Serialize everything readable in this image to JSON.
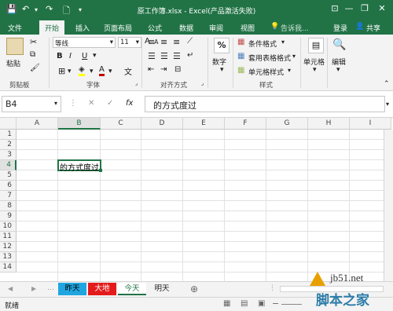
{
  "window": {
    "title": "原工作簿.xlsx - Excel(产品激活失败)",
    "minimize": "—",
    "restore": "❐",
    "close": "✕",
    "ribbon_options": "⊡"
  },
  "quick_access": {
    "save": "💾",
    "undo": "↶",
    "redo": "↷",
    "new": "🗋",
    "customize": "▾"
  },
  "tabs": [
    {
      "label": "文件"
    },
    {
      "label": "开始"
    },
    {
      "label": "插入"
    },
    {
      "label": "页面布局"
    },
    {
      "label": "公式"
    },
    {
      "label": "数据"
    },
    {
      "label": "审阅"
    },
    {
      "label": "视图"
    }
  ],
  "tell_me": "告诉我...",
  "login": "登录",
  "share": "共享",
  "ribbon": {
    "clipboard": {
      "paste": "粘贴",
      "label": "剪贴板"
    },
    "font": {
      "name": "等线",
      "size": "11",
      "bold": "B",
      "italic": "I",
      "underline": "U",
      "grow": "A",
      "shrink": "A",
      "label": "字体",
      "font_color_letter": "A",
      "font_color": "#c00000",
      "fill_color": "#ffff00"
    },
    "alignment": {
      "label": "对齐方式"
    },
    "number": {
      "pct": "%",
      "label": "数字"
    },
    "styles": {
      "conditional": "条件格式",
      "table": "套用表格格式",
      "cell_styles": "单元格样式",
      "label": "样式"
    },
    "cells": {
      "label": "单元格"
    },
    "editing": {
      "label": "编辑"
    }
  },
  "formula_bar": {
    "name_box": "B4",
    "cancel": "✕",
    "enter": "✓",
    "fx": "fx",
    "content": "的方式度过"
  },
  "grid": {
    "columns": [
      "A",
      "B",
      "C",
      "D",
      "E",
      "F",
      "G",
      "H",
      "I"
    ],
    "rows": [
      "1",
      "2",
      "3",
      "4",
      "5",
      "6",
      "7",
      "8",
      "9",
      "10",
      "11",
      "12",
      "13",
      "14"
    ],
    "active_cell": "B4",
    "cell_B4": "的方式度过",
    "accent": "#217346"
  },
  "sheets": [
    {
      "label": "昨天",
      "color": "#1fa6e0"
    },
    {
      "label": "大地",
      "color": "#e41b1b"
    },
    {
      "label": "今天",
      "color": "#ffffff"
    },
    {
      "label": "明天",
      "color": "#f3f3f3"
    }
  ],
  "sheet_nav": {
    "prev": "◀",
    "next": "▶",
    "add": "⊕"
  },
  "status": {
    "mode": "就绪"
  },
  "watermark": {
    "site": "jb51.net",
    "name": "脚本之家"
  }
}
